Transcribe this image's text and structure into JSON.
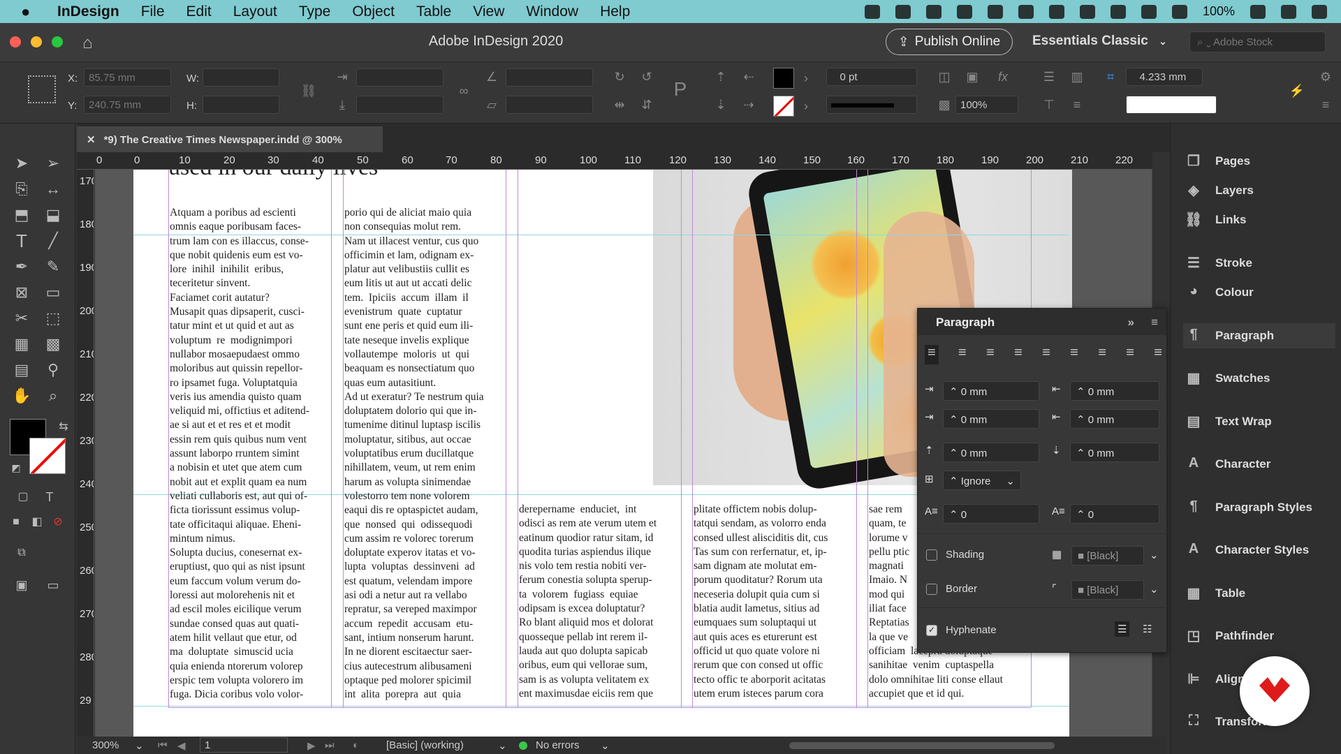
{
  "menubar": {
    "apple": "",
    "items": [
      "InDesign",
      "File",
      "Edit",
      "Layout",
      "Type",
      "Object",
      "Table",
      "View",
      "Window",
      "Help"
    ],
    "battery": "100%"
  },
  "titlebar": {
    "title": "Adobe InDesign 2020",
    "publish_label": "Publish Online",
    "workspace": "Essentials Classic",
    "stock_placeholder": "Adobe Stock"
  },
  "control": {
    "x_label": "X:",
    "x_value": "85.75 mm",
    "y_label": "Y:",
    "y_value": "240.75 mm",
    "w_label": "W:",
    "h_label": "H:",
    "stroke_weight": "0 pt",
    "opacity": "100%",
    "gap": "4.233 mm"
  },
  "tab": {
    "label": "*9) The Creative Times Newspaper.indd @ 300%"
  },
  "ruler": {
    "h": [
      "0",
      "0",
      "10",
      "20",
      "30",
      "40",
      "50",
      "60",
      "70",
      "80",
      "90",
      "100",
      "110",
      "120",
      "130",
      "140",
      "150",
      "160",
      "170",
      "180",
      "190",
      "200",
      "210",
      "220"
    ],
    "v": [
      "170",
      "180",
      "190",
      "200",
      "210",
      "220",
      "230",
      "240",
      "250",
      "260",
      "270",
      "280",
      "29"
    ]
  },
  "document": {
    "headline_fragment": "used in our daily lives",
    "col1": "Atquam a poribus ad escienti\nomnis eaque poribusam faces-\ntrum lam con es illaccus, conse-\nque nobit quidenis eum est vo-\nlore  inihil  inihilit  eribus,\nteceritetur sinvent.\nFaciamet corit autatur?\nMusapit quas dipsaperit, cusci-\ntatur mint et ut quid et aut as\nvoluptum  re  modignimpori\nnullabor mosaepudaest ommo\nmoloribus aut quissin repellor-\nro ipsamet fuga. Voluptatquia\nveris ius amendia quisto quam\nveliquid mi, offictius et aditend-\nae si aut et et res et et modit\nessin rem quis quibus num vent\nassunt laborpo rruntem simint\na nobisin et utet que atem cum\nnobit aut et explit quam ea num\nveliati cullaboris est, aut qui of-\nficta tiorissunt essimus volup-\ntate officitaqui aliquae. Eheni-\nmintum nimus.\nSolupta ducius, conesernat ex-\neruptiust, quo qui as nist ipsunt\neum faccum volum verum do-\nloressi aut molorehenis nit et\nad escil moles eicilique verum\nsundae consed quas aut quati-\natem hilit vellaut que etur, od\nma  doluptate  simuscid ucia\nquia enienda ntorerum volorep\nerspic tem volupta volorero im\nfuga. Dicia coribus volo volor-",
    "col2": "porio qui de aliciat maio quia\nnon consequias molut rem.\nNam ut illacest ventur, cus quo\nofficimin et lam, odignam ex-\nplatur aut velibustiis cullit es\neum litis ut aut ut accati delic\ntem.  Ipiciis  accum  illam  il\nevenistrum  quate  cuptatur\nsunt ene peris et quid eum ili-\ntate neseque invelis explique\nvollautempe  moloris  ut  qui\nbeaquam es nonsectiatum quo\nquas eum autasitiunt.\nAd ut exeratur? Te nestrum quia\ndoluptatem dolorio qui que in-\ntumenime ditinul luptasp iscilis\nmoluptatur, sitibus, aut occae\nvoluptatibus erum ducillatque\nnihillatem, veum, ut rem enim\nharum as volupta sinimendae\nvolestorro tem none volorem\neaqui dis re optaspictet audam,\nque  nonsed  qui  odissequodi\ncum assim re volorec torerum\ndoluptate experov itatas et vo-\nlupta  voluptas  dessinveni  ad\nest quatum, velendam impore\nasi odi a netur aut ra vellabo\nrepratur, sa vereped maximpor\naccum  repedit  accusam  etu-\nsant, intium nonserum harunt.\nIn ne diorent escitaectur saer-\ncius autecestrum alibusameni\noptaque ped molorer spicimil\nint  alita  porepra  aut  quia",
    "col3": "derepername  enduciet,  int\nodisci as rem ate verum utem et\neatinum quodior ratur sitam, id\nquodita turias aspiendus ilique\nnis volo tem restia nobiti ver-\nferum conestia solupta sperup-\nta  volorem  fugiass  equiae\nodipsam is excea doluptatur?\nRo blant aliquid mos et dolorat\nquosseque pellab int rerem il-\nlauda aut quo dolupta sapicab\noribus, eum qui vellorae sum,\nsam is as volupta velitatem ex\nent maximusdae eiciis rem que",
    "col4": "plitate offictem nobis dolup-\ntatqui sendam, as volorro enda\nconsed ullest alisciditis dit, cus\nTas sum con rerfernatur, et, ip-\nsam dignam ate molutat em-\nporum quoditatur? Rorum uta\nneceseria dolupit quia cum si\nblatia audit lametus, sitius ad\neumquaes sum soluptaqui ut\naut quis aces es eturerunt est\nofficid ut quo quate volore ni\nrerum que con consed ut offic\ntecto offic te aborporit acitatas\nutem erum isteces parum cora",
    "col5": "sae rem\nquam, te\nlorume v\npellu ptic\nmagnati\nImaio. N\nmod qui\niliat face\nReptatias\nla que ve\nofficiam  lacepra doluptaque\nsanihitae  venim  cuptaspella\ndolo omnihitae liti conse ellaut\naccupiet que et id qui."
  },
  "status": {
    "zoom": "300%",
    "page": "1",
    "style": "[Basic] (working)",
    "preflight": "No errors"
  },
  "dock": {
    "items": [
      "Pages",
      "Layers",
      "Links",
      "Stroke",
      "Colour",
      "Paragraph",
      "Swatches",
      "Text Wrap",
      "Character",
      "Paragraph Styles",
      "Character Styles",
      "Table",
      "Pathfinder",
      "Align",
      "Transform"
    ]
  },
  "paragraph_panel": {
    "title": "Paragraph",
    "left_indent": "0 mm",
    "right_indent": "0 mm",
    "first_line_indent": "0 mm",
    "last_line_indent": "0 mm",
    "space_before": "0 mm",
    "space_after": "0 mm",
    "align_to_grid": "Ignore",
    "drop_cap_lines": "0",
    "drop_cap_chars": "0",
    "shading_label": "Shading",
    "shading_color": "[Black]",
    "border_label": "Border",
    "border_color": "[Black]",
    "hyphenate_label": "Hyphenate"
  }
}
